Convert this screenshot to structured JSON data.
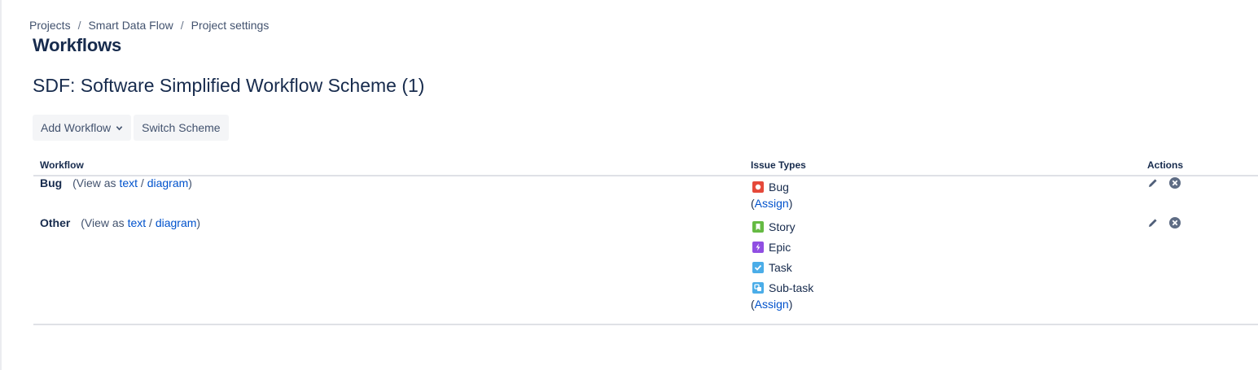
{
  "breadcrumb": [
    "Projects",
    "Smart Data Flow",
    "Project settings"
  ],
  "page_title": "Workflows",
  "scheme_title": "SDF: Software Simplified Workflow Scheme (1)",
  "toolbar": {
    "add_workflow": "Add Workflow",
    "switch_scheme": "Switch Scheme"
  },
  "table": {
    "headers": [
      "Workflow",
      "Issue Types",
      "Actions"
    ],
    "rows": [
      {
        "name": "Bug",
        "view_prefix": "(View as",
        "text_link": "text",
        "slash": "/",
        "diagram_link": "diagram",
        "view_suffix": ")",
        "issue_types": [
          {
            "label": "Bug",
            "icon": "bug-icon",
            "color": "#e5493a"
          }
        ],
        "assign_open": "(",
        "assign": "Assign",
        "assign_close": ")"
      },
      {
        "name": "Other",
        "view_prefix": "(View as",
        "text_link": "text",
        "slash": "/",
        "diagram_link": "diagram",
        "view_suffix": ")",
        "issue_types": [
          {
            "label": "Story",
            "icon": "story-icon",
            "color": "#65ba43"
          },
          {
            "label": "Epic",
            "icon": "epic-icon",
            "color": "#904ee2"
          },
          {
            "label": "Task",
            "icon": "task-icon",
            "color": "#4bade8"
          },
          {
            "label": "Sub-task",
            "icon": "subtask-icon",
            "color": "#4bade8"
          }
        ],
        "assign_open": "(",
        "assign": "Assign",
        "assign_close": ")"
      }
    ]
  },
  "action_icons": [
    "edit-icon",
    "delete-icon"
  ]
}
